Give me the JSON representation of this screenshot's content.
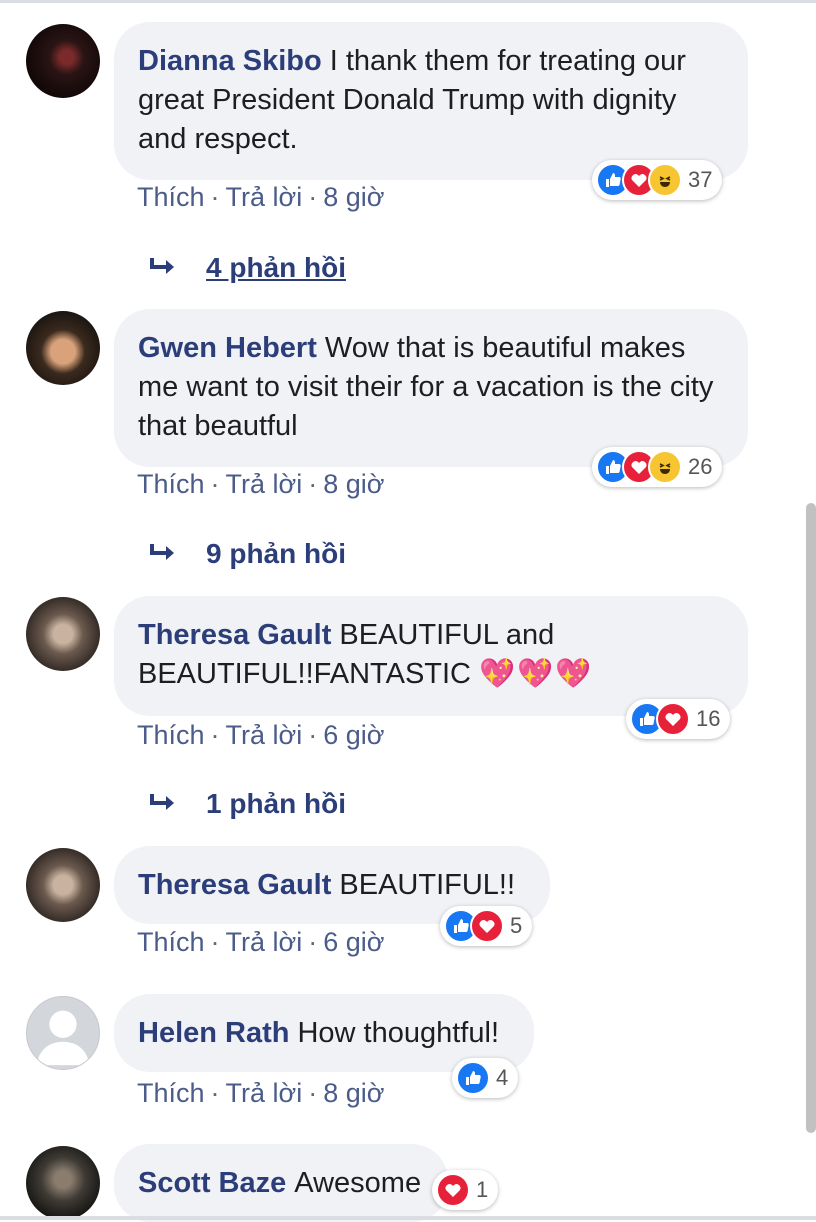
{
  "comments": [
    {
      "author": "Dianna Skibo",
      "text": "I thank them for treating our great President Donald Trump with dignity and respect.",
      "reaction_count": "37",
      "actions": {
        "like": "Thích",
        "reply": "Trả lời",
        "time": "8 giờ"
      },
      "replies_label": "4 phản hồi"
    },
    {
      "author": "Gwen Hebert",
      "text": "Wow that is beautiful makes me want to visit their for a vacation is the city that beautful",
      "reaction_count": "26",
      "actions": {
        "like": "Thích",
        "reply": "Trả lời",
        "time": "8 giờ"
      },
      "replies_label": "9 phản hồi"
    },
    {
      "author": "Theresa Gault",
      "text": "BEAUTIFUL and BEAUTIFUL!!FANTASTIC",
      "emoji": "💖💖💖",
      "reaction_count": "16",
      "actions": {
        "like": "Thích",
        "reply": "Trả lời",
        "time": "6 giờ"
      },
      "replies_label": "1 phản hồi"
    },
    {
      "author": "Theresa Gault",
      "text": "BEAUTIFUL!!",
      "reaction_count": "5",
      "actions": {
        "like": "Thích",
        "reply": "Trả lời",
        "time": "6 giờ"
      }
    },
    {
      "author": "Helen Rath",
      "text": "How thoughtful!",
      "reaction_count": "4",
      "actions": {
        "like": "Thích",
        "reply": "Trả lời",
        "time": "8 giờ"
      }
    },
    {
      "author": "Scott Baze",
      "text": "Awesome",
      "reaction_count": "1"
    }
  ],
  "colors": {
    "name": "#2c3e7a",
    "like": "#1877f2",
    "love": "#e8213a",
    "haha": "#f7c531",
    "bubble": "#f0f2f5"
  },
  "icons": [
    "like-icon",
    "love-icon",
    "haha-icon",
    "reply-arrow-icon"
  ]
}
